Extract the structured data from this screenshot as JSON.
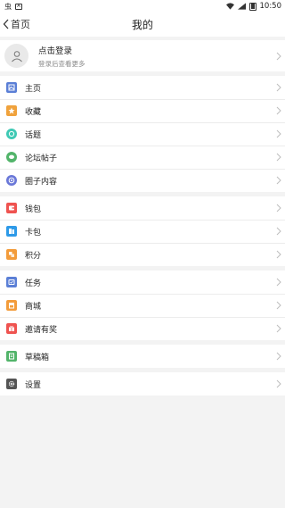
{
  "statusbar": {
    "app_glyph": "虫",
    "time": "10:50"
  },
  "navbar": {
    "back_label": "首页",
    "title": "我的"
  },
  "profile": {
    "title": "点击登录",
    "subtitle": "登录后查看更多"
  },
  "colors": {
    "blue": "#5b7fd6",
    "orange": "#f0a23c",
    "teal": "#3fc9b4",
    "green": "#52b46a",
    "indigo": "#6a78d8",
    "red": "#ef5350",
    "sky": "#2e9ae8",
    "amber": "#f39c3b",
    "gray": "#555555"
  },
  "menu": {
    "group1": [
      {
        "label": "主页",
        "icon": "homepage-icon"
      },
      {
        "label": "收藏",
        "icon": "favorite-icon"
      },
      {
        "label": "话题",
        "icon": "topic-icon"
      },
      {
        "label": "论坛帖子",
        "icon": "forum-posts-icon"
      },
      {
        "label": "圈子内容",
        "icon": "circle-content-icon"
      }
    ],
    "group2": [
      {
        "label": "钱包",
        "icon": "wallet-icon"
      },
      {
        "label": "卡包",
        "icon": "card-pack-icon"
      },
      {
        "label": "积分",
        "icon": "points-icon"
      }
    ],
    "group3": [
      {
        "label": "任务",
        "icon": "tasks-icon"
      },
      {
        "label": "商城",
        "icon": "mall-icon"
      },
      {
        "label": "邀请有奖",
        "icon": "invite-reward-icon"
      }
    ],
    "group4": [
      {
        "label": "草稿箱",
        "icon": "drafts-icon"
      }
    ],
    "group5": [
      {
        "label": "设置",
        "icon": "settings-icon"
      }
    ]
  }
}
